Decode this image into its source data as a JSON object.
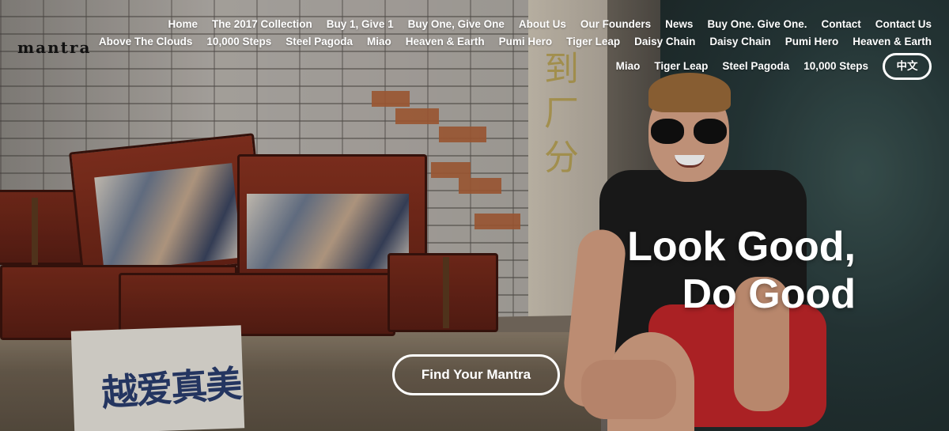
{
  "header": {
    "logo": "mantra",
    "nav_row1": [
      "Home",
      "The 2017 Collection",
      "Buy 1, Give 1",
      "Buy One, Give One",
      "About Us",
      "Our Founders",
      "News",
      "Buy One. Give One.",
      "Contact",
      "Contact Us"
    ],
    "nav_row2": [
      "Above The Clouds",
      "10,000 Steps",
      "Steel Pagoda",
      "Miao",
      "Heaven & Earth",
      "Pumi Hero",
      "Tiger Leap",
      "Daisy Chain",
      "Daisy Chain",
      "Pumi Hero",
      "Heaven & Earth"
    ],
    "nav_row3": [
      "Miao",
      "Tiger Leap",
      "Steel Pagoda",
      "10,000 Steps"
    ],
    "language_button": "中文"
  },
  "hero": {
    "headline_line1": "Look Good,",
    "headline_line2": "Do Good",
    "cta_label": "Find Your Mantra",
    "cloth_text": "越爱真美"
  },
  "colors": {
    "text": "#ffffff",
    "logo": "#111111",
    "shorts_accent": "#c2262a"
  }
}
